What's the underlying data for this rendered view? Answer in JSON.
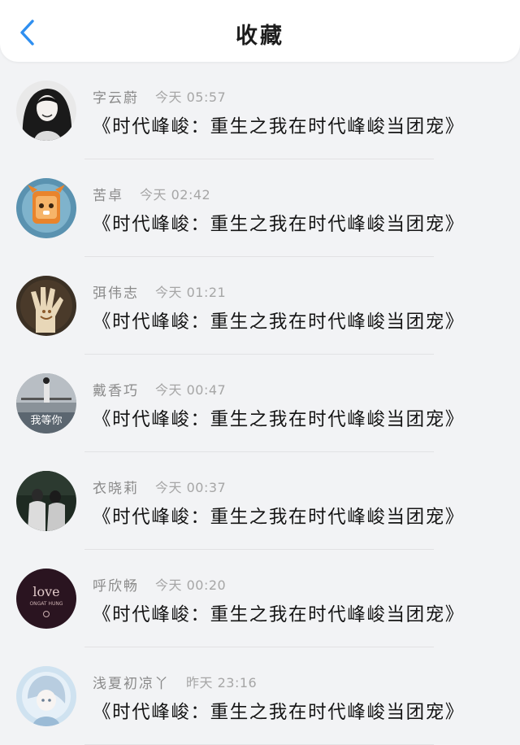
{
  "header": {
    "title": "收藏",
    "back_icon": "chevron-left-icon",
    "accent_color": "#2f8ff0"
  },
  "items": [
    {
      "name": "字云蔚",
      "time": "今天 05:57",
      "book": "《时代峰峻：重生之我在时代峰峻当团宠》"
    },
    {
      "name": "苦卓",
      "time": "今天 02:42",
      "book": "《时代峰峻：重生之我在时代峰峻当团宠》"
    },
    {
      "name": "弭伟志",
      "time": "今天 01:21",
      "book": "《时代峰峻：重生之我在时代峰峻当团宠》"
    },
    {
      "name": "戴香巧",
      "time": "今天 00:47",
      "book": "《时代峰峻：重生之我在时代峰峻当团宠》",
      "avatar_caption": "我等你"
    },
    {
      "name": "衣晓莉",
      "time": "今天 00:37",
      "book": "《时代峰峻：重生之我在时代峰峻当团宠》"
    },
    {
      "name": "呼欣畅",
      "time": "今天 00:20",
      "book": "《时代峰峻：重生之我在时代峰峻当团宠》",
      "avatar_caption": "love",
      "avatar_subcaption": "ONGAT HUNG"
    },
    {
      "name": "浅夏初凉丫",
      "time": "昨天 23:16",
      "book": "《时代峰峻：重生之我在时代峰峻当团宠》"
    }
  ]
}
